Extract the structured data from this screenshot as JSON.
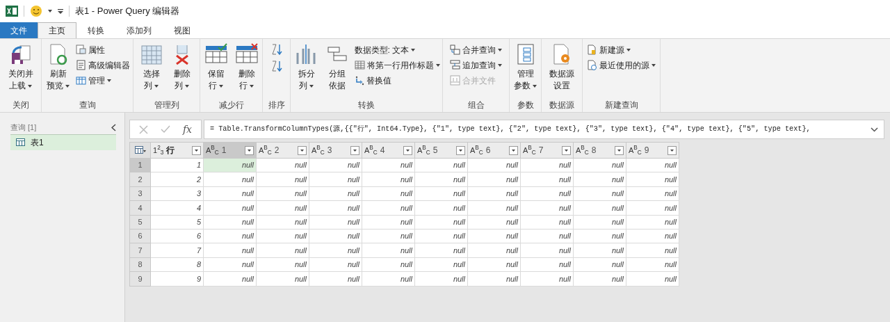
{
  "window": {
    "title": "表1 - Power Query 编辑器"
  },
  "tabs": [
    {
      "label": "文件",
      "kind": "file",
      "selected": false
    },
    {
      "label": "主页",
      "kind": "tab",
      "selected": true
    },
    {
      "label": "转换",
      "kind": "tab",
      "selected": false
    },
    {
      "label": "添加列",
      "kind": "tab",
      "selected": false
    },
    {
      "label": "视图",
      "kind": "tab",
      "selected": false
    }
  ],
  "ribbon": [
    {
      "label": "关闭",
      "items": [
        {
          "kind": "large",
          "lines": [
            "关闭并",
            "上载"
          ],
          "dropdown": true
        }
      ]
    },
    {
      "label": "查询",
      "items": [
        {
          "kind": "large",
          "lines": [
            "刷新",
            "预览"
          ],
          "dropdown": true
        },
        {
          "kind": "small",
          "label": "属性",
          "dropdown": false,
          "disabled": false
        },
        {
          "kind": "small",
          "label": "高级编辑器",
          "dropdown": false,
          "disabled": false
        },
        {
          "kind": "small",
          "label": "管理",
          "dropdown": true,
          "disabled": false
        }
      ]
    },
    {
      "label": "管理列",
      "items": [
        {
          "kind": "large",
          "lines": [
            "选择",
            "列"
          ],
          "dropdown": true
        },
        {
          "kind": "large",
          "lines": [
            "删除",
            "列"
          ],
          "dropdown": true
        }
      ]
    },
    {
      "label": "减少行",
      "items": [
        {
          "kind": "large",
          "lines": [
            "保留",
            "行"
          ],
          "dropdown": true
        },
        {
          "kind": "large",
          "lines": [
            "删除",
            "行"
          ],
          "dropdown": true
        }
      ]
    },
    {
      "label": "排序",
      "items": [
        {
          "kind": "icon"
        },
        {
          "kind": "icon"
        }
      ]
    },
    {
      "label": "转换",
      "items": [
        {
          "kind": "large",
          "lines": [
            "拆分",
            "列"
          ],
          "dropdown": true
        },
        {
          "kind": "large",
          "lines": [
            "分组",
            "依据"
          ],
          "dropdown": false
        },
        {
          "kind": "small",
          "label": "数据类型: 文本",
          "dropdown": true,
          "disabled": false
        },
        {
          "kind": "small",
          "label": "将第一行用作标题",
          "dropdown": true,
          "disabled": false
        },
        {
          "kind": "small",
          "label": "替换值",
          "dropdown": false,
          "disabled": false
        }
      ]
    },
    {
      "label": "组合",
      "items": [
        {
          "kind": "small",
          "label": "合并查询",
          "dropdown": true,
          "disabled": false
        },
        {
          "kind": "small",
          "label": "追加查询",
          "dropdown": true,
          "disabled": false
        },
        {
          "kind": "small",
          "label": "合并文件",
          "dropdown": false,
          "disabled": true
        }
      ]
    },
    {
      "label": "参数",
      "items": [
        {
          "kind": "large",
          "lines": [
            "管理",
            "参数"
          ],
          "dropdown": true
        }
      ]
    },
    {
      "label": "数据源",
      "items": [
        {
          "kind": "large",
          "lines": [
            "数据源",
            "设置"
          ],
          "dropdown": false
        }
      ]
    },
    {
      "label": "新建查询",
      "items": [
        {
          "kind": "small",
          "label": "新建源",
          "dropdown": true,
          "disabled": false
        },
        {
          "kind": "small",
          "label": "最近使用的源",
          "dropdown": true,
          "disabled": false
        }
      ]
    }
  ],
  "queries_pane": {
    "title": "查询 [1]",
    "items": [
      {
        "label": "表1",
        "selected": true
      }
    ]
  },
  "formula_bar": {
    "fx": "fx",
    "formula": "= Table.TransformColumnTypes(源,{{\"行\", Int64.Type}, {\"1\", type text}, {\"2\", type text}, {\"3\", type text}, {\"4\", type text}, {\"5\", type text},"
  },
  "table": {
    "columns": [
      {
        "type_label": "1$^{2}$$_{3}$",
        "label": "行",
        "selected": false
      },
      {
        "type_label": "A$^{B}$$_{C}$",
        "label": "1",
        "selected": true
      },
      {
        "type_label": "A$^{B}$$_{C}$",
        "label": "2",
        "selected": false
      },
      {
        "type_label": "A$^{B}$$_{C}$",
        "label": "3",
        "selected": false
      },
      {
        "type_label": "A$^{B}$$_{C}$",
        "label": "4",
        "selected": false
      },
      {
        "type_label": "A$^{B}$$_{C}$",
        "label": "5",
        "selected": false
      },
      {
        "type_label": "A$^{B}$$_{C}$",
        "label": "6",
        "selected": false
      },
      {
        "type_label": "A$^{B}$$_{C}$",
        "label": "7",
        "selected": false
      },
      {
        "type_label": "A$^{B}$$_{C}$",
        "label": "8",
        "selected": false
      },
      {
        "type_label": "A$^{B}$$_{C}$",
        "label": "9",
        "selected": false
      }
    ],
    "rows": [
      {
        "number": "1",
        "selected": true,
        "cells": [
          "1",
          "null",
          "null",
          "null",
          "null",
          "null",
          "null",
          "null",
          "null",
          "null"
        ]
      },
      {
        "number": "2",
        "selected": false,
        "cells": [
          "2",
          "null",
          "null",
          "null",
          "null",
          "null",
          "null",
          "null",
          "null",
          "null"
        ]
      },
      {
        "number": "3",
        "selected": false,
        "cells": [
          "3",
          "null",
          "null",
          "null",
          "null",
          "null",
          "null",
          "null",
          "null",
          "null"
        ]
      },
      {
        "number": "4",
        "selected": false,
        "cells": [
          "4",
          "null",
          "null",
          "null",
          "null",
          "null",
          "null",
          "null",
          "null",
          "null"
        ]
      },
      {
        "number": "5",
        "selected": false,
        "cells": [
          "5",
          "null",
          "null",
          "null",
          "null",
          "null",
          "null",
          "null",
          "null",
          "null"
        ]
      },
      {
        "number": "6",
        "selected": false,
        "cells": [
          "6",
          "null",
          "null",
          "null",
          "null",
          "null",
          "null",
          "null",
          "null",
          "null"
        ]
      },
      {
        "number": "7",
        "selected": false,
        "cells": [
          "7",
          "null",
          "null",
          "null",
          "null",
          "null",
          "null",
          "null",
          "null",
          "null"
        ]
      },
      {
        "number": "8",
        "selected": false,
        "cells": [
          "8",
          "null",
          "null",
          "null",
          "null",
          "null",
          "null",
          "null",
          "null",
          "null"
        ]
      },
      {
        "number": "9",
        "selected": false,
        "cells": [
          "9",
          "null",
          "null",
          "null",
          "null",
          "null",
          "null",
          "null",
          "null",
          "null"
        ]
      }
    ]
  }
}
